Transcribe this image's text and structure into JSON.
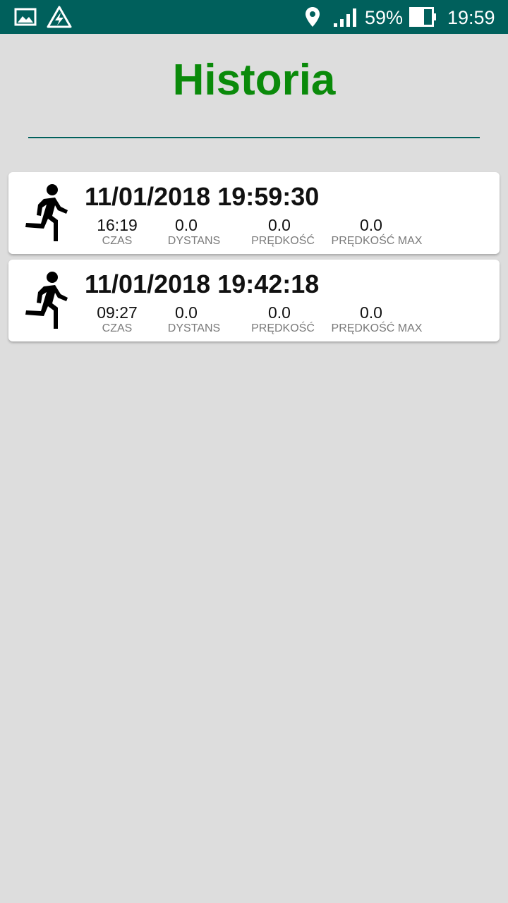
{
  "status_bar": {
    "icons": [
      "gallery-icon",
      "flash-icon",
      "location-icon",
      "signal-icon",
      "battery-icon"
    ],
    "battery": "59%",
    "time": "19:59",
    "background_color": "#00605c"
  },
  "page": {
    "title": "Historia",
    "title_color": "#0a8a0a",
    "accent_color": "#00605c"
  },
  "history": [
    {
      "icon": "run-icon",
      "datetime": "11/01/2018 19:59:30",
      "stats": [
        {
          "value": "16:19",
          "label": "CZAS"
        },
        {
          "value": "0.0",
          "label": "DYSTANS"
        },
        {
          "value": "0.0",
          "label": "PRĘDKOŚĆ"
        },
        {
          "value": "0.0",
          "label": "PRĘDKOŚĆ MAX"
        }
      ]
    },
    {
      "icon": "run-icon",
      "datetime": "11/01/2018 19:42:18",
      "stats": [
        {
          "value": "09:27",
          "label": "CZAS"
        },
        {
          "value": "0.0",
          "label": "DYSTANS"
        },
        {
          "value": "0.0",
          "label": "PRĘDKOŚĆ"
        },
        {
          "value": "0.0",
          "label": "PRĘDKOŚĆ MAX"
        }
      ]
    }
  ]
}
